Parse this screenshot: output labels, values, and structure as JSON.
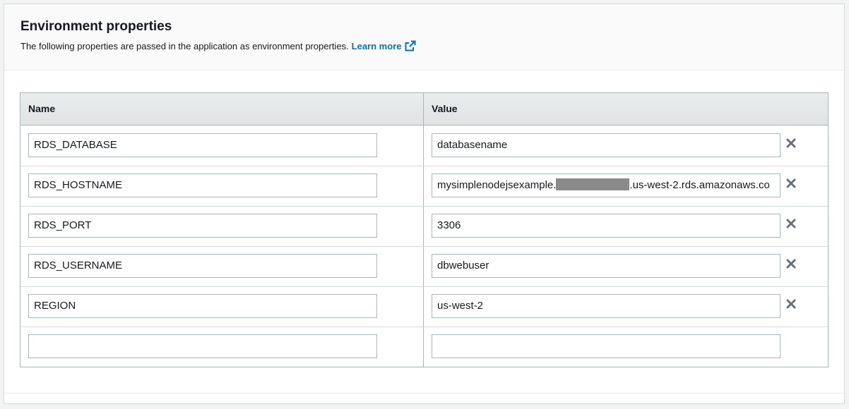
{
  "section": {
    "title": "Environment properties",
    "description": "The following properties are passed in the application as environment properties.",
    "learn_more": "Learn more"
  },
  "table": {
    "headers": {
      "name": "Name",
      "value": "Value"
    },
    "rows": [
      {
        "name": "RDS_DATABASE",
        "value": "databasename"
      },
      {
        "name": "RDS_HOSTNAME",
        "value_prefix": "mysimplenodejsexample.",
        "value_suffix": ".us-west-2.rds.amazonaws.co",
        "value_redacted": true
      },
      {
        "name": "RDS_PORT",
        "value": "3306"
      },
      {
        "name": "RDS_USERNAME",
        "value": "dbwebuser"
      },
      {
        "name": "REGION",
        "value": "us-west-2"
      },
      {
        "name": "",
        "value": ""
      }
    ]
  },
  "icons": {
    "external_link": "external-link-icon",
    "remove": "close-x-icon"
  },
  "colors": {
    "link": "#0073bb",
    "remove_icon": "#687078"
  }
}
